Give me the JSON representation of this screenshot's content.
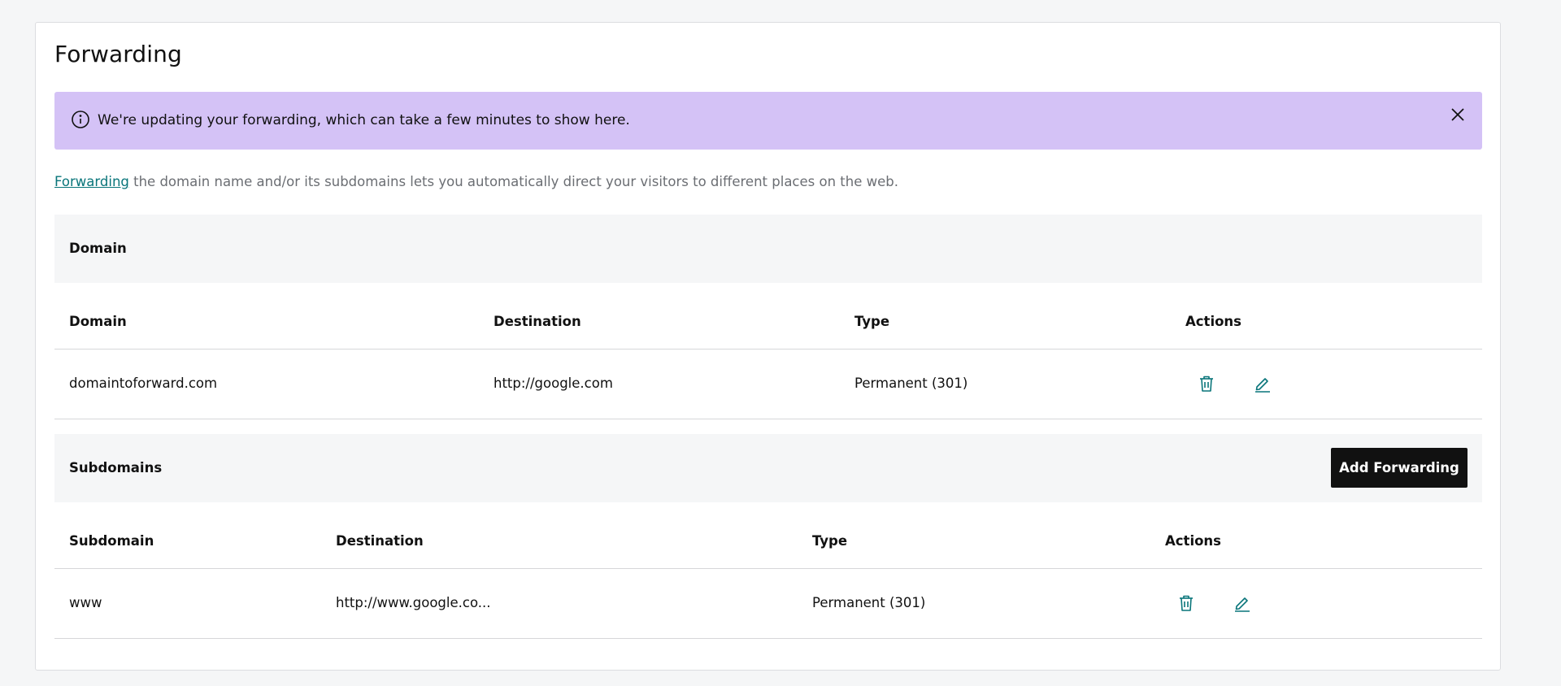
{
  "page": {
    "title": "Forwarding"
  },
  "alert": {
    "message": "We're updating your forwarding, which can take a few minutes to show here.",
    "background": "#d4c2f6",
    "icon": "info-icon",
    "close_icon": "close-icon"
  },
  "intro": {
    "link_text": "Forwarding",
    "rest": " the domain name and/or its subdomains lets you automatically direct your visitors to different places on the web."
  },
  "domain_section": {
    "title": "Domain",
    "columns": [
      "Domain",
      "Destination",
      "Type",
      "Actions"
    ],
    "rows": [
      {
        "domain": "domaintoforward.com",
        "destination": "http://google.com",
        "type": "Permanent (301)"
      }
    ]
  },
  "subdomain_section": {
    "title": "Subdomains",
    "add_button_label": "Add Forwarding",
    "columns": [
      "Subdomain",
      "Destination",
      "Type",
      "Actions"
    ],
    "rows": [
      {
        "subdomain": "www",
        "destination": "http://www.google.co...",
        "type": "Permanent (301)"
      }
    ]
  },
  "colors": {
    "accent": "#09757a",
    "button": "#111111",
    "alert": "#d4c2f6",
    "section_bg": "#f5f6f7"
  },
  "action_icons": [
    "trash-icon",
    "pencil-icon"
  ]
}
